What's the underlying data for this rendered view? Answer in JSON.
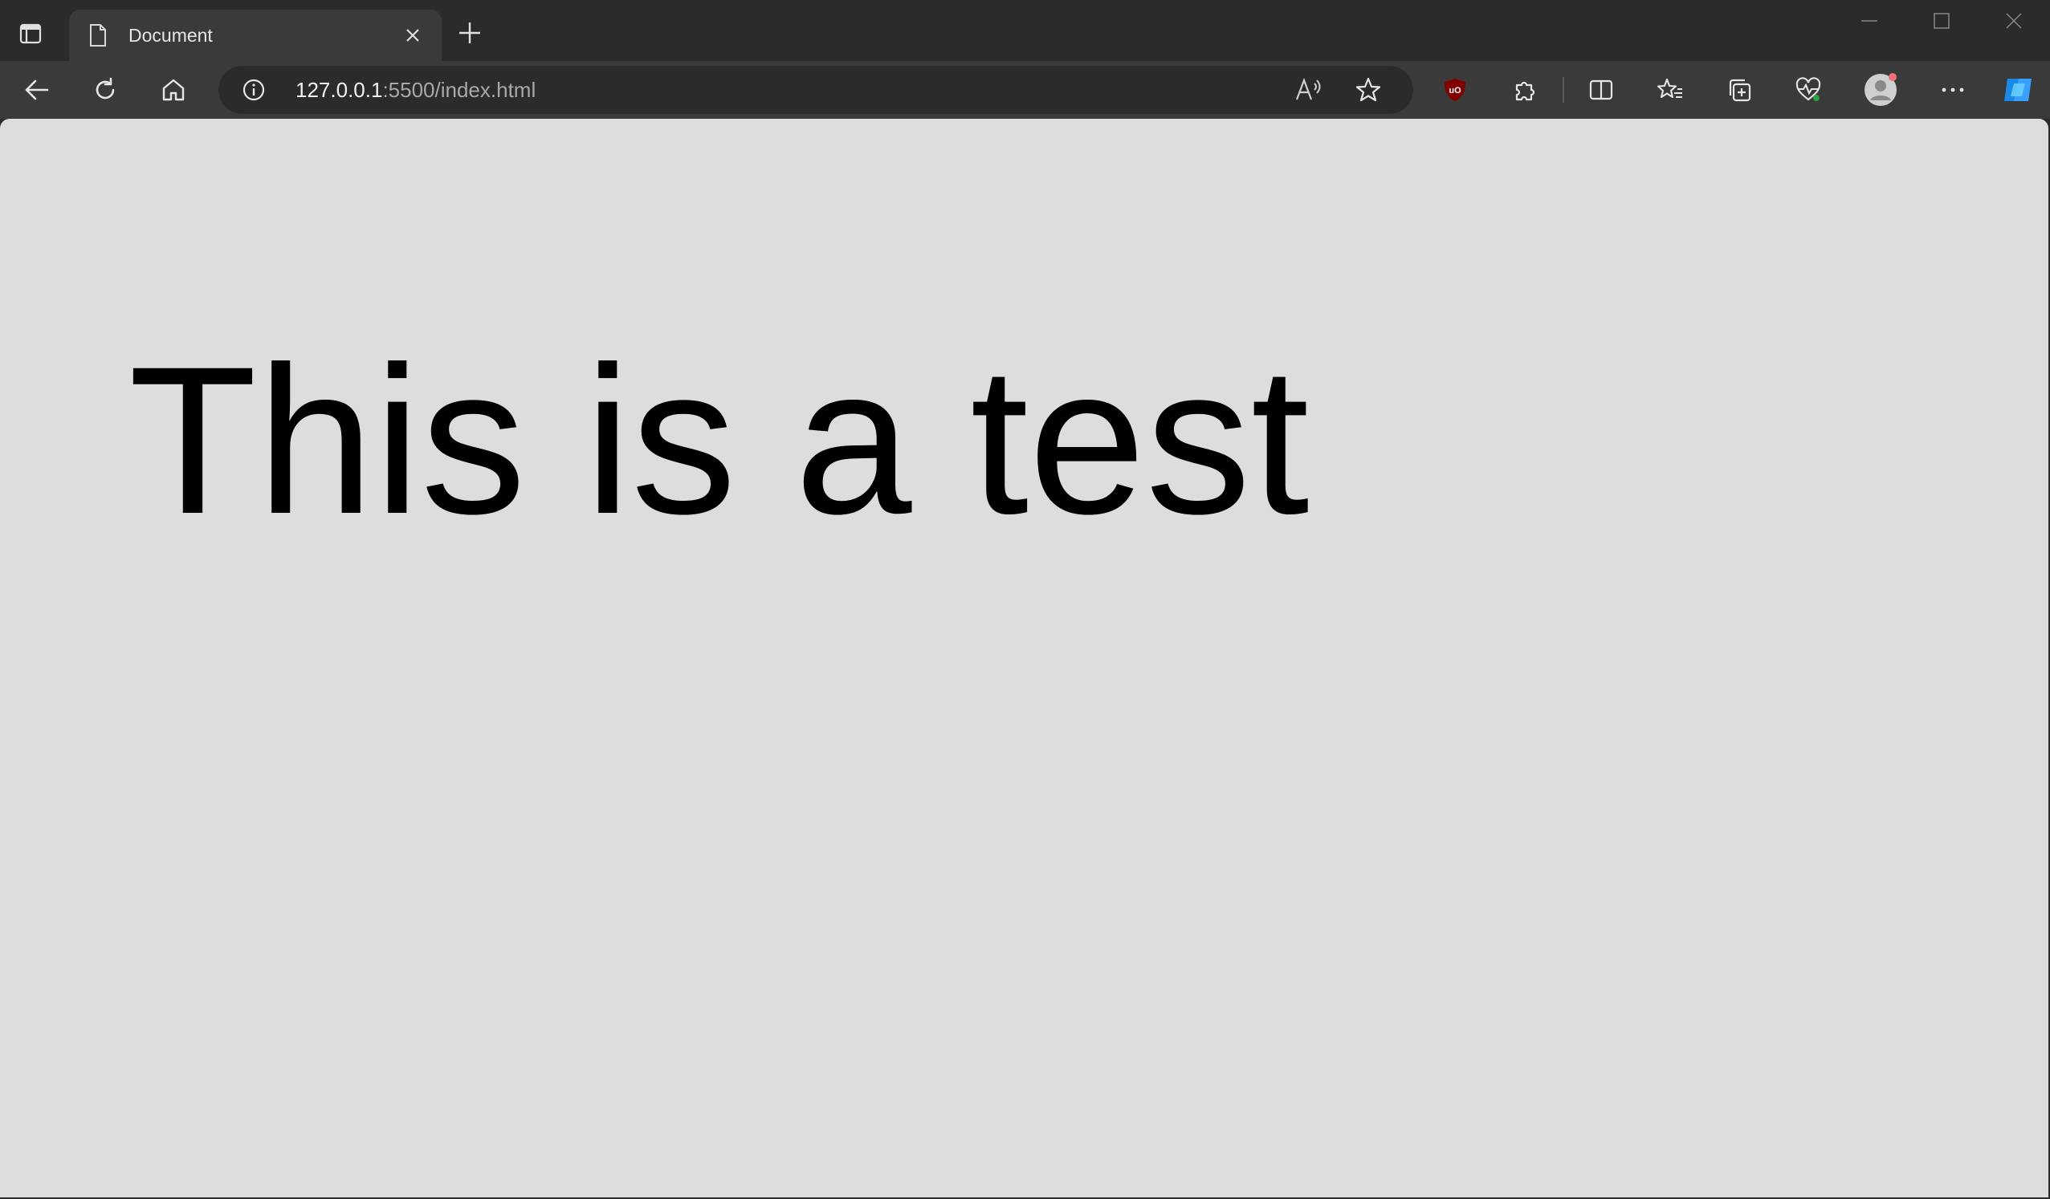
{
  "browser": {
    "tab": {
      "title": "Document"
    },
    "address": {
      "host": "127.0.0.1",
      "path": ":5500/index.html"
    },
    "icons": {
      "tab_actions": "tab-actions-icon",
      "document": "document-icon",
      "close": "close-icon",
      "new_tab": "plus-icon",
      "back": "back-arrow-icon",
      "refresh": "refresh-icon",
      "home": "home-icon",
      "info": "info-icon",
      "read_aloud": "read-aloud-icon",
      "favorite": "star-icon",
      "ublock": "ublock-origin-icon",
      "extensions": "puzzle-icon",
      "split_screen": "split-screen-icon",
      "favorites": "favorites-list-icon",
      "collections": "collections-icon",
      "performance": "heartbeat-icon",
      "profile": "profile-avatar-icon",
      "menu": "more-icon",
      "copilot": "copilot-icon"
    },
    "colors": {
      "chrome": "#2b2b2b",
      "toolbar": "#3a3a3a",
      "page": "#dddddd",
      "ublock_red": "#800000"
    }
  },
  "page": {
    "heading": "This is a test"
  }
}
